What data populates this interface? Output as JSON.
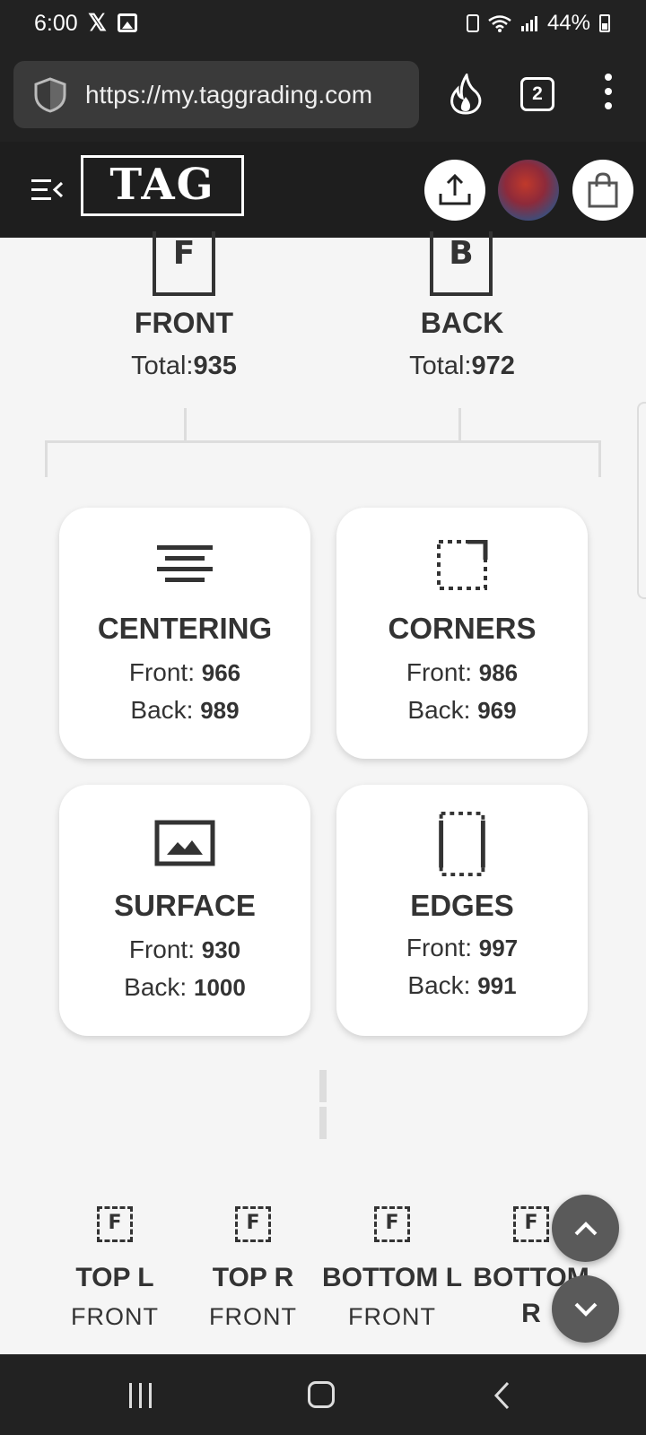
{
  "status_bar": {
    "time": "6:00",
    "x_glyph": "𝕏",
    "battery": "44%"
  },
  "browser": {
    "url": "https://my.taggrading.com",
    "tab_count": "2"
  },
  "header": {
    "logo": "TAG"
  },
  "sides": {
    "front": {
      "letter": "F",
      "title": "FRONT",
      "total_label": "Total:",
      "total": "935"
    },
    "back": {
      "letter": "B",
      "title": "BACK",
      "total_label": "Total:",
      "total": "972"
    }
  },
  "cards": {
    "centering": {
      "title": "CENTERING",
      "front_label": "Front:",
      "front": "966",
      "back_label": "Back:",
      "back": "989"
    },
    "corners": {
      "title": "CORNERS",
      "front_label": "Front:",
      "front": "986",
      "back_label": "Back:",
      "back": "969"
    },
    "surface": {
      "title": "SURFACE",
      "front_label": "Front:",
      "front": "930",
      "back_label": "Back:",
      "back": "1000"
    },
    "edges": {
      "title": "EDGES",
      "front_label": "Front:",
      "front": "997",
      "back_label": "Back:",
      "back": "991"
    }
  },
  "positions": [
    {
      "letter": "F",
      "title": "TOP L",
      "sub": "FRONT"
    },
    {
      "letter": "F",
      "title": "TOP R",
      "sub": "FRONT"
    },
    {
      "letter": "F",
      "title": "BOTTOM L",
      "sub": "FRONT"
    },
    {
      "letter": "F",
      "title": "BOTTOM R",
      "sub": ""
    }
  ],
  "colors": {
    "background": "#f5f5f5",
    "dark_bar": "#222222",
    "fab": "#5a5a5a",
    "text": "#333333"
  }
}
